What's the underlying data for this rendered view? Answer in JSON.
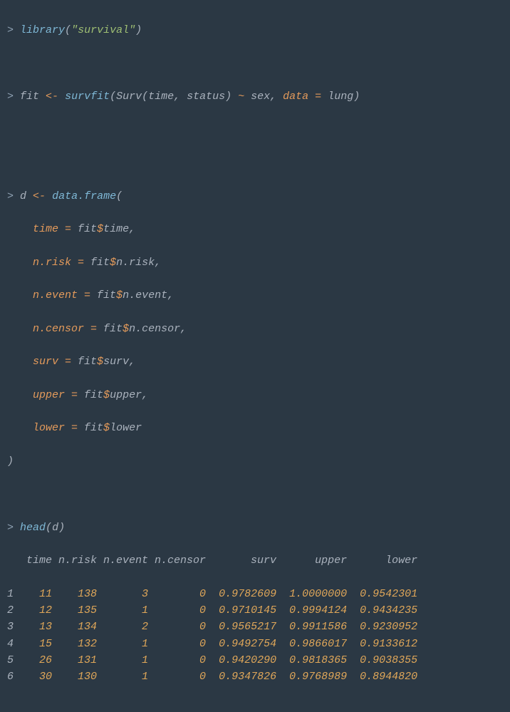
{
  "lines": {
    "l1": {
      "prompt": ">",
      "func": "library",
      "open": "(",
      "str": "\"survival\"",
      "close": ")"
    },
    "l2": {
      "prompt": ">",
      "t": "fit ",
      "arrow": "<-",
      "sp": " ",
      "func": "survfit",
      "open": "(",
      "inner": "Surv(time, status) ",
      "tilde": "~",
      "rest": " sex, ",
      "kw": "data =",
      "rest2": " lung",
      "close": ")"
    },
    "l3": {
      "prompt": ">",
      "t": "d ",
      "arrow": "<-",
      "sp": " ",
      "func": "data.frame",
      "open": "("
    },
    "a1": {
      "kw": "time =",
      "rhs": " fit",
      "d": "$",
      "field": "time,"
    },
    "a2": {
      "kw": "n.risk =",
      "rhs": " fit",
      "d": "$",
      "field": "n.risk,"
    },
    "a3": {
      "kw": "n.event =",
      "rhs": " fit",
      "d": "$",
      "field": "n.event,"
    },
    "a4": {
      "kw": "n.censor =",
      "rhs": " fit",
      "d": "$",
      "field": "n.censor,"
    },
    "a5": {
      "kw": "surv =",
      "rhs": " fit",
      "d": "$",
      "field": "surv,"
    },
    "a6": {
      "kw": "upper =",
      "rhs": " fit",
      "d": "$",
      "field": "upper,"
    },
    "a7": {
      "kw": "lower =",
      "rhs": " fit",
      "d": "$",
      "field": "lower"
    },
    "close": {
      "t": ")"
    },
    "l4": {
      "prompt": ">",
      "func": "head",
      "open": "(",
      "arg": "d",
      "close": ")"
    }
  },
  "table": {
    "headers": [
      "",
      "time",
      "n.risk",
      "n.event",
      "n.censor",
      "surv",
      "upper",
      "lower"
    ],
    "rows": [
      {
        "idx": "1",
        "time": "11",
        "nrisk": "138",
        "nevent": "3",
        "ncensor": "0",
        "surv": "0.9782609",
        "upper": "1.0000000",
        "lower": "0.9542301"
      },
      {
        "idx": "2",
        "time": "12",
        "nrisk": "135",
        "nevent": "1",
        "ncensor": "0",
        "surv": "0.9710145",
        "upper": "0.9994124",
        "lower": "0.9434235"
      },
      {
        "idx": "3",
        "time": "13",
        "nrisk": "134",
        "nevent": "2",
        "ncensor": "0",
        "surv": "0.9565217",
        "upper": "0.9911586",
        "lower": "0.9230952"
      },
      {
        "idx": "4",
        "time": "15",
        "nrisk": "132",
        "nevent": "1",
        "ncensor": "0",
        "surv": "0.9492754",
        "upper": "0.9866017",
        "lower": "0.9133612"
      },
      {
        "idx": "5",
        "time": "26",
        "nrisk": "131",
        "nevent": "1",
        "ncensor": "0",
        "surv": "0.9420290",
        "upper": "0.9818365",
        "lower": "0.9038355"
      },
      {
        "idx": "6",
        "time": "30",
        "nrisk": "130",
        "nevent": "1",
        "ncensor": "0",
        "surv": "0.9347826",
        "upper": "0.9768989",
        "lower": "0.8944820"
      }
    ]
  },
  "chart_data": {
    "type": "table",
    "title": "head(d) — survfit summary table",
    "columns": [
      "time",
      "n.risk",
      "n.event",
      "n.censor",
      "surv",
      "upper",
      "lower"
    ],
    "rows": [
      [
        11,
        138,
        3,
        0,
        0.9782609,
        1.0,
        0.9542301
      ],
      [
        12,
        135,
        1,
        0,
        0.9710145,
        0.9994124,
        0.9434235
      ],
      [
        13,
        134,
        2,
        0,
        0.9565217,
        0.9911586,
        0.9230952
      ],
      [
        15,
        132,
        1,
        0,
        0.9492754,
        0.9866017,
        0.9133612
      ],
      [
        26,
        131,
        1,
        0,
        0.942029,
        0.9818365,
        0.9038355
      ],
      [
        30,
        130,
        1,
        0,
        0.9347826,
        0.9768989,
        0.894482
      ]
    ]
  }
}
